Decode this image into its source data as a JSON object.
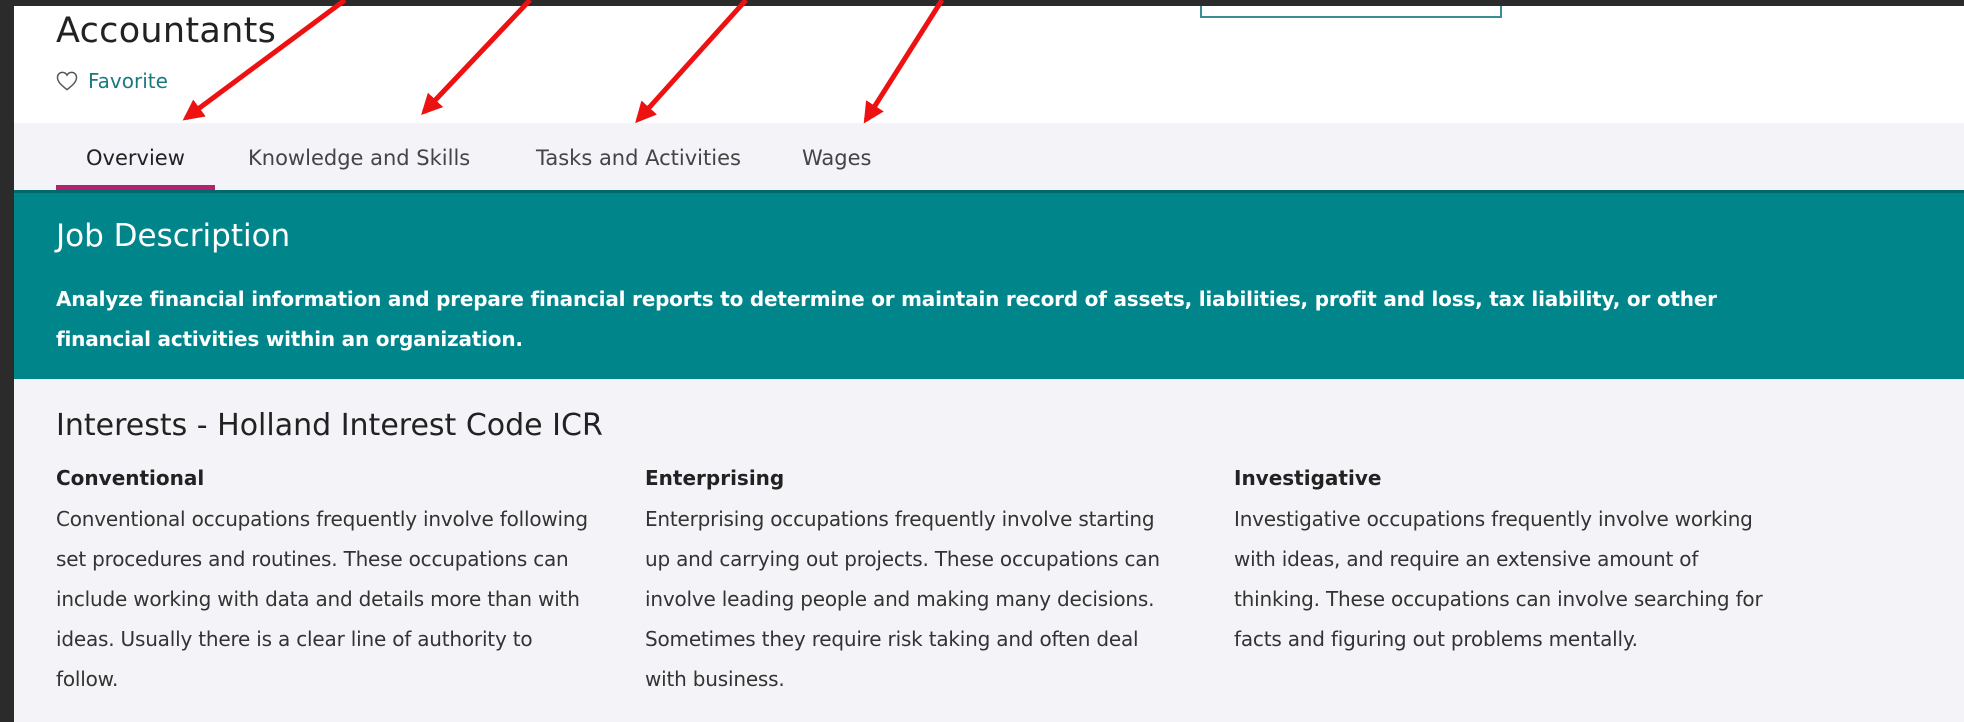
{
  "header": {
    "title": "Accountants",
    "favorite_label": "Favorite"
  },
  "tabs": [
    {
      "label": "Overview",
      "active": true
    },
    {
      "label": "Knowledge and Skills",
      "active": false
    },
    {
      "label": "Tasks and Activities",
      "active": false
    },
    {
      "label": "Wages",
      "active": false
    }
  ],
  "job_description": {
    "heading": "Job Description",
    "text": "Analyze financial information and prepare financial reports to determine or maintain record of assets, liabilities, profit and loss, tax liability, or other financial activities within an organization."
  },
  "interests": {
    "heading": "Interests - Holland Interest Code ICR",
    "items": [
      {
        "title": "Conventional",
        "text": "Conventional occupations frequently involve following set procedures and routines. These occupations can include working with data and details more than with ideas. Usually there is a clear line of authority to follow."
      },
      {
        "title": "Enterprising",
        "text": "Enterprising occupations frequently involve starting up and carrying out projects. These occupations can involve leading people and making many decisions. Sometimes they require risk taking and often deal with business."
      },
      {
        "title": "Investigative",
        "text": "Investigative occupations frequently involve working with ideas, and require an extensive amount of thinking. These occupations can involve searching for facts and figuring out problems mentally."
      }
    ]
  },
  "colors": {
    "frame": "#2b2b2b",
    "teal_banner": "#00858b",
    "link_teal": "#1a7a80",
    "active_tab_underline": "#b4226c",
    "section_bg": "#f4f4f8",
    "arrow": "#ee1111"
  },
  "icons": {
    "favorite": "heart-outline-icon"
  }
}
